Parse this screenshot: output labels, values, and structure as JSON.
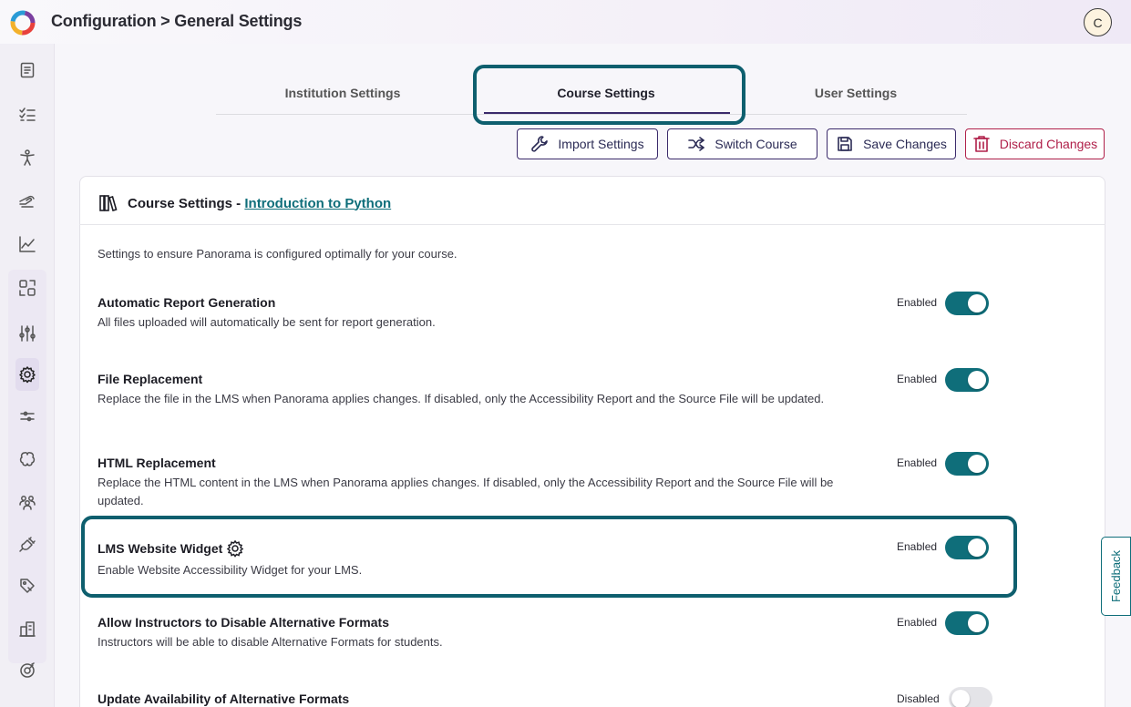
{
  "header": {
    "title": "Configuration > General Settings",
    "avatar_initial": "C"
  },
  "sidebar": {
    "items": [
      {
        "icon": "document-icon"
      },
      {
        "icon": "checklist-icon"
      },
      {
        "icon": "accessibility-icon"
      },
      {
        "icon": "hand-icon"
      },
      {
        "icon": "chart-icon"
      },
      {
        "icon": "integrations-icon"
      },
      {
        "icon": "sliders-icon"
      },
      {
        "icon": "gear-icon",
        "active": true
      },
      {
        "icon": "filters-icon"
      },
      {
        "icon": "brain-icon"
      },
      {
        "icon": "users-icon"
      },
      {
        "icon": "plug-icon"
      },
      {
        "icon": "tag-icon"
      },
      {
        "icon": "building-icon"
      },
      {
        "icon": "support-icon"
      }
    ]
  },
  "tabs": [
    {
      "label": "Institution Settings"
    },
    {
      "label": "Course Settings",
      "active": true
    },
    {
      "label": "User Settings"
    }
  ],
  "toolbar": {
    "import_label": "Import Settings",
    "switch_label": "Switch Course",
    "save_label": "Save Changes",
    "discard_label": "Discard Changes"
  },
  "card": {
    "title_prefix": "Course Settings - ",
    "course_name": "Introduction to Python",
    "intro": "Settings to ensure Panorama is configured optimally for your course."
  },
  "settings": [
    {
      "title": "Automatic Report Generation",
      "description": "All files uploaded will automatically be sent for report generation.",
      "status": "Enabled",
      "enabled": true
    },
    {
      "title": "File Replacement",
      "description": "Replace the file in the LMS when Panorama applies changes. If disabled, only the Accessibility Report and the Source File will be updated.",
      "status": "Enabled",
      "enabled": true
    },
    {
      "title": "HTML Replacement",
      "description": "Replace the HTML content in the LMS when Panorama applies changes. If disabled, only the Accessibility Report and the Source File will be updated.",
      "status": "Enabled",
      "enabled": true
    },
    {
      "title": "LMS Website Widget",
      "description": "Enable Website Accessibility Widget for your LMS.",
      "status": "Enabled",
      "enabled": true
    },
    {
      "title": "Allow Instructors to Disable Alternative Formats",
      "description": "Instructors will be able to disable Alternative Formats for students.",
      "status": "Enabled",
      "enabled": true
    },
    {
      "title": "Update Availability of Alternative Formats",
      "description": "",
      "status": "Disabled",
      "enabled": false
    }
  ],
  "feedback_label": "Feedback",
  "colors": {
    "accent": "#0f6e7a",
    "brand_dark": "#3b2a6b",
    "danger": "#b0204a"
  }
}
